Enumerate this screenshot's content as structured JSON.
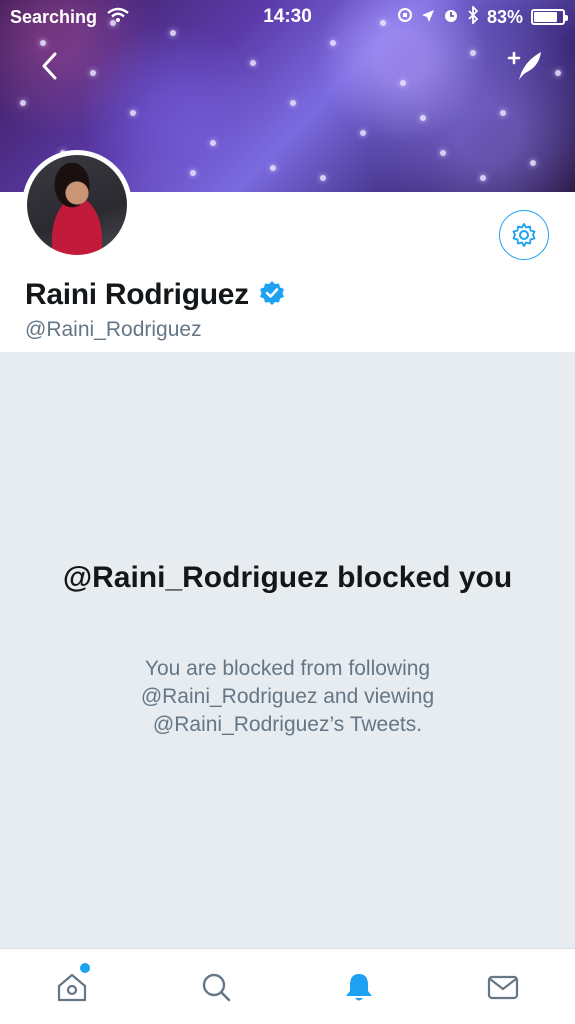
{
  "status_bar": {
    "carrier": "Searching",
    "time": "14:30",
    "battery": "83%",
    "battery_level": 0.83
  },
  "header": {
    "back_icon": "chevron-left-icon",
    "compose_icon": "compose-tweet-icon"
  },
  "profile": {
    "display_name": "Raini Rodriguez",
    "handle": "@Raini_Rodriguez",
    "verified": true,
    "settings_icon": "gear-icon"
  },
  "blocked": {
    "title": "@Raini_Rodriguez blocked you",
    "description": "You are blocked from following @Raini_Rodriguez and viewing @Raini_Rodriguez’s Tweets."
  },
  "tab_bar": {
    "items": [
      {
        "icon": "home-icon",
        "has_badge": true,
        "active": false
      },
      {
        "icon": "search-icon",
        "has_badge": false,
        "active": false
      },
      {
        "icon": "notifications-icon",
        "has_badge": false,
        "active": true
      },
      {
        "icon": "messages-icon",
        "has_badge": false,
        "active": false
      }
    ]
  },
  "colors": {
    "accent": "#1da1f2",
    "text_primary": "#14171a",
    "text_secondary": "#657786",
    "background": "#e6ecf0"
  }
}
